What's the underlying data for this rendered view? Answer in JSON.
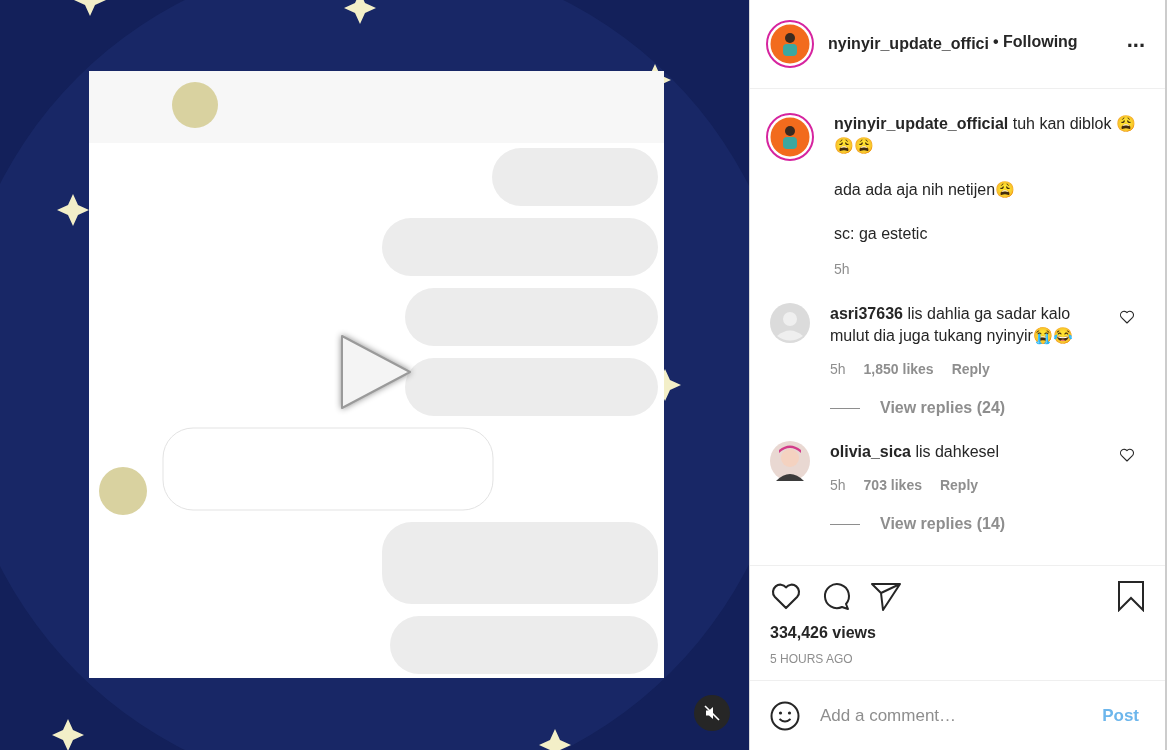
{
  "video": {
    "kind": "picture",
    "muted": true
  },
  "header": {
    "username": "nyinyir_update_offici",
    "follow": "• Following",
    "more": "..."
  },
  "caption": {
    "username": "nyinyir_update_official",
    "lines": [
      "tuh kan diblok 😩😩😩",
      "ada ada aja nih netijen😩",
      "sc: ga estetic"
    ],
    "time": "5h"
  },
  "comments": [
    {
      "username": "asri37636",
      "text": "lis dahlia ga sadar kalo mulut dia juga tukang nyinyir😭😂",
      "time": "5h",
      "likes": "1,850 likes",
      "reply": "Reply",
      "replies": "View replies (24)",
      "kind": "blank",
      "liked": false
    },
    {
      "username": "olivia_sica",
      "text": "lis dahkesel",
      "time": "5h",
      "likes": "703 likes",
      "reply": "Reply",
      "replies": "View replies (14)",
      "liked": false
    }
  ],
  "actions": {
    "liked": false,
    "saved": false
  },
  "views": "334,426 views",
  "posted": "5 HOURS AGO",
  "comment_box": {
    "placeholder": "Add a comment…",
    "post": "Post",
    "disabled": true
  }
}
